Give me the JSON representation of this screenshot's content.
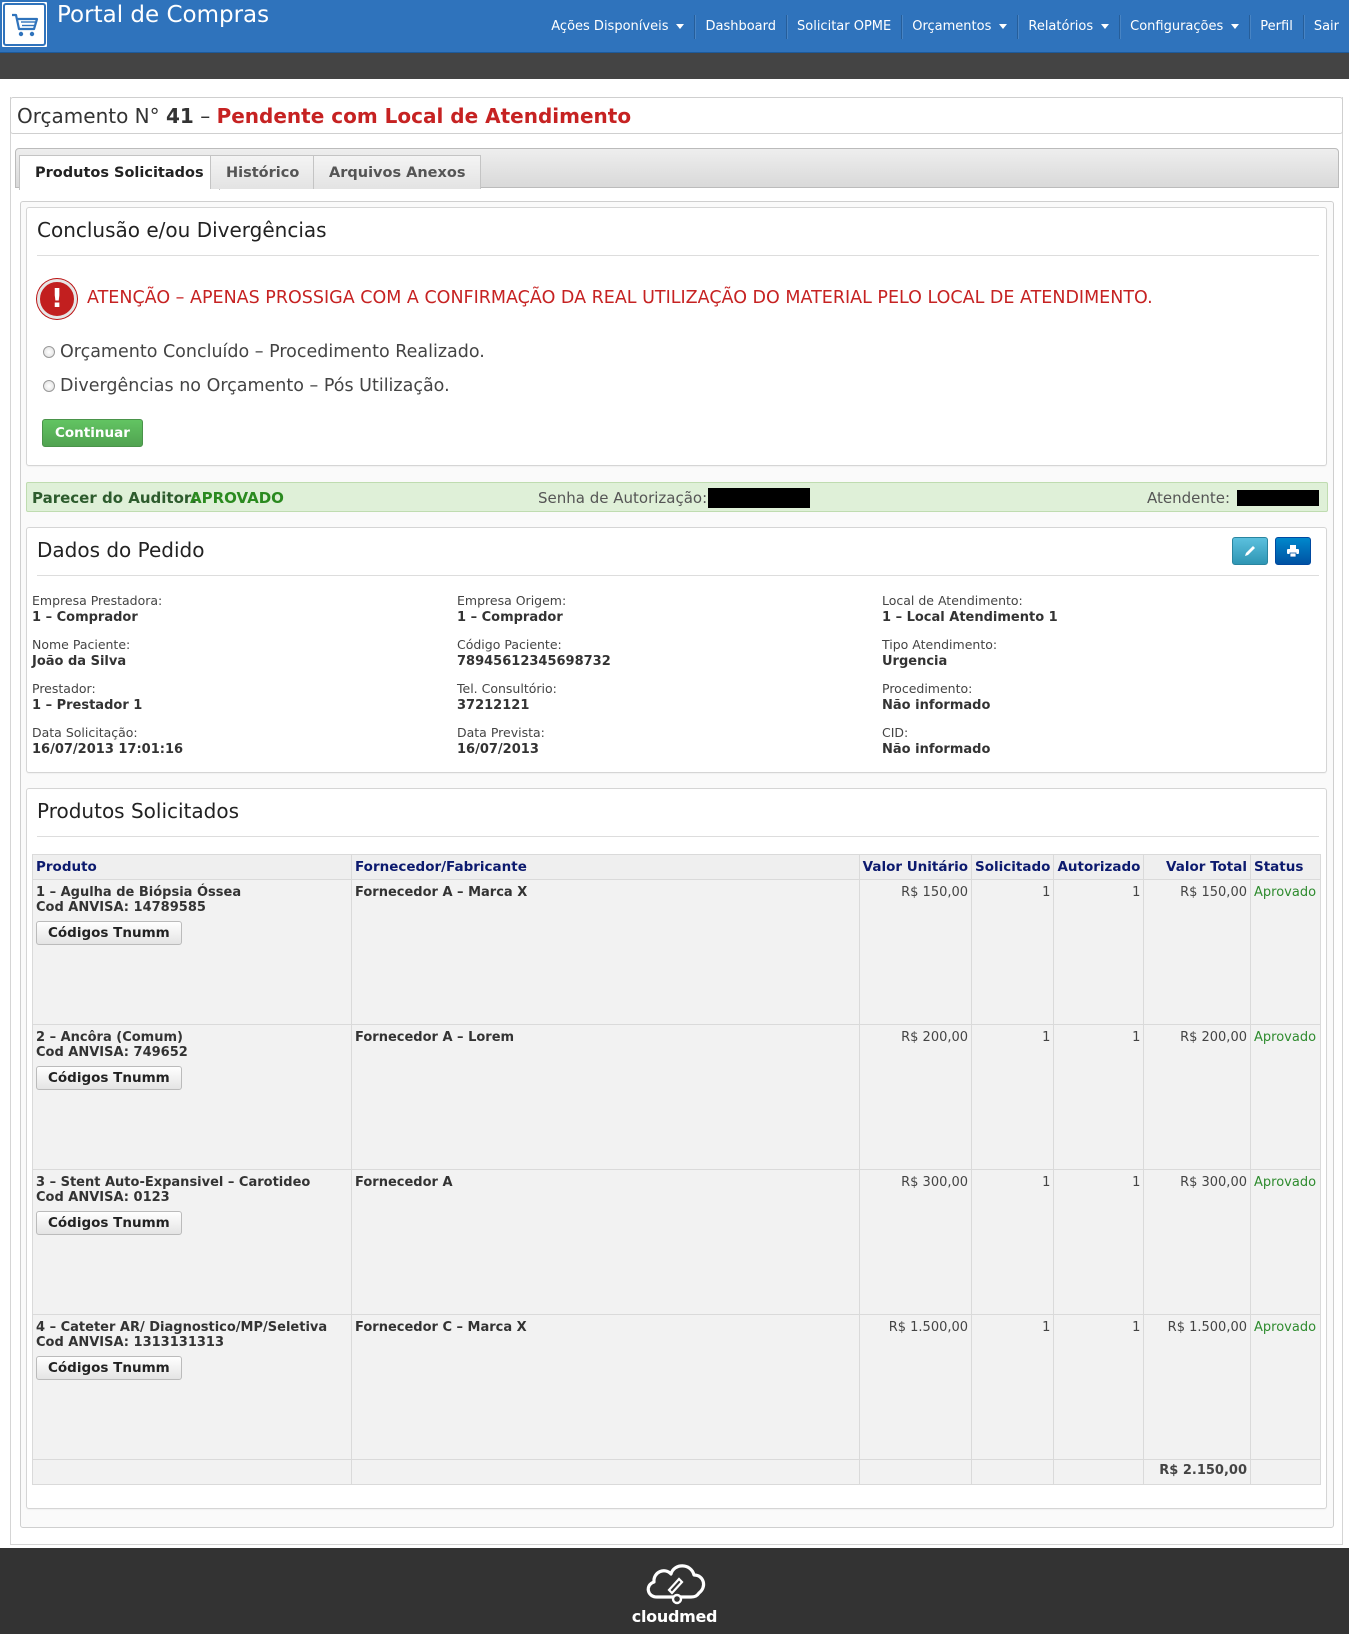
{
  "app": {
    "title": "Portal de Compras",
    "logo_icon": "shopping-cart-icon"
  },
  "nav": {
    "items": [
      {
        "label": "Ações Disponíveis",
        "dropdown": true
      },
      {
        "label": "Dashboard",
        "dropdown": false
      },
      {
        "label": "Solicitar OPME",
        "dropdown": false
      },
      {
        "label": "Orçamentos",
        "dropdown": true
      },
      {
        "label": "Relatórios",
        "dropdown": true
      },
      {
        "label": "Configurações",
        "dropdown": true
      },
      {
        "label": "Perfil",
        "dropdown": false
      },
      {
        "label": "Sair",
        "dropdown": false
      }
    ]
  },
  "header": {
    "prefix": "Orçamento N°",
    "number": "41",
    "separator": "–",
    "status": "Pendente com Local de Atendimento"
  },
  "tabs": [
    {
      "label": "Produtos Solicitados",
      "active": true
    },
    {
      "label": "Histórico",
      "active": false
    },
    {
      "label": "Arquivos Anexos",
      "active": false
    }
  ],
  "conclusion": {
    "title": "Conclusão e/ou Divergências",
    "alert_icon": "exclamation-circle-icon",
    "alert_text": "ATENÇÃO – APENAS PROSSIGA COM A CONFIRMAÇÃO DA REAL UTILIZAÇÃO DO MATERIAL PELO LOCAL DE ATENDIMENTO.",
    "options": [
      "Orçamento Concluído – Procedimento Realizado.",
      "Divergências no Orçamento – Pós Utilização."
    ],
    "continue_label": "Continuar"
  },
  "auditor": {
    "label": "Parecer do Auditor:",
    "value": "APROVADO",
    "auth_label": "Senha de Autorização:",
    "attendant_label": "Atendente:"
  },
  "order": {
    "title": "Dados do Pedido",
    "edit_icon": "pencil-icon",
    "print_icon": "printer-icon",
    "fields": [
      {
        "label": "Empresa Prestadora:",
        "value": "1 – Comprador"
      },
      {
        "label": "Empresa Origem:",
        "value": "1 – Comprador"
      },
      {
        "label": "Local de Atendimento:",
        "value": "1 – Local Atendimento 1"
      },
      {
        "label": "Nome Paciente:",
        "value": "João da Silva"
      },
      {
        "label": "Código Paciente:",
        "value": "78945612345698732"
      },
      {
        "label": "Tipo Atendimento:",
        "value": "Urgencia"
      },
      {
        "label": "Prestador:",
        "value": "1 – Prestador 1"
      },
      {
        "label": "Tel. Consultório:",
        "value": "37212121"
      },
      {
        "label": "Procedimento:",
        "value": "Não informado"
      },
      {
        "label": "Data Solicitação:",
        "value": "16/07/2013 17:01:16"
      },
      {
        "label": "Data Prevista:",
        "value": "16/07/2013"
      },
      {
        "label": "CID:",
        "value": "Não informado"
      }
    ]
  },
  "products": {
    "title": "Produtos Solicitados",
    "columns": [
      "Produto",
      "Fornecedor/Fabricante",
      "Valor Unitário",
      "Solicitado",
      "Autorizado",
      "Valor Total",
      "Status"
    ],
    "anvisa_label": "Cod ANVISA:",
    "tnumm_label": "Códigos Tnumm",
    "rows": [
      {
        "name": "1 – Agulha de Biópsia Óssea",
        "anvisa": "14789585",
        "supplier": "Fornecedor A – Marca X",
        "unit": "R$ 150,00",
        "requested": "1",
        "authorized": "1",
        "total": "R$ 150,00",
        "status": "Aprovado"
      },
      {
        "name": "2 – Ancôra (Comum)",
        "anvisa": "749652",
        "supplier": "Fornecedor A – Lorem",
        "unit": "R$ 200,00",
        "requested": "1",
        "authorized": "1",
        "total": "R$ 200,00",
        "status": "Aprovado"
      },
      {
        "name": "3 – Stent Auto-Expansivel – Carotideo",
        "anvisa": "0123",
        "supplier": "Fornecedor A",
        "unit": "R$ 300,00",
        "requested": "1",
        "authorized": "1",
        "total": "R$ 300,00",
        "status": "Aprovado"
      },
      {
        "name": "4 – Cateter AR/ Diagnostico/MP/Seletiva",
        "anvisa": "1313131313",
        "supplier": "Fornecedor C – Marca X",
        "unit": "R$ 1.500,00",
        "requested": "1",
        "authorized": "1",
        "total": "R$ 1.500,00",
        "status": "Aprovado"
      }
    ],
    "grand_total": "R$ 2.150,00"
  },
  "footer": {
    "brand": "cloudmed",
    "icon": "cloud-icon"
  },
  "colors": {
    "primary": "#2f73bc",
    "danger": "#c62222",
    "success": "#2e8b2e",
    "nav_dark": "#444444",
    "footer": "#333333"
  }
}
